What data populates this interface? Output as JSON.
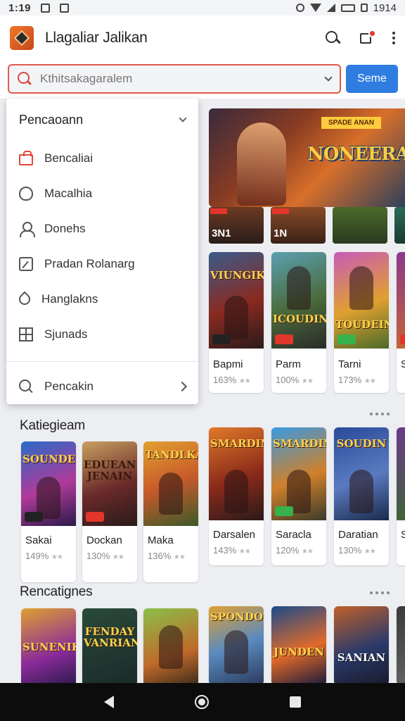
{
  "status_bar": {
    "time": "1:19",
    "right_text": "1914"
  },
  "app_bar": {
    "title": "Llagaliar Jalikan"
  },
  "search": {
    "placeholder": "Kthitsakagaralem",
    "button_label": "Seme"
  },
  "dropdown": {
    "header": "Pencaoann",
    "items": [
      {
        "label": "Bencaliai",
        "icon": "shopping-bag-icon"
      },
      {
        "label": "Macalhia",
        "icon": "shield-icon"
      },
      {
        "label": "Donehs",
        "icon": "user-icon"
      },
      {
        "label": "Pradan Rolanarg",
        "icon": "edit-icon"
      },
      {
        "label": "Hanglakns",
        "icon": "drop-icon"
      },
      {
        "label": "Sjunads",
        "icon": "grid-icon"
      }
    ],
    "footer": "Pencakin"
  },
  "hero": {
    "title": "NONEERAN",
    "tag": "SPADE ANAN"
  },
  "featured_thumbs": [
    {
      "num": "3N1"
    },
    {
      "num": "1N"
    },
    {
      "num": ""
    },
    {
      "num": ""
    }
  ],
  "row_one": [
    {
      "title_art": "VIUNGIK",
      "name": "Bapmi",
      "rating": "163%"
    },
    {
      "title_art": "ICOUDIN",
      "name": "Parm",
      "rating": "100%"
    },
    {
      "title_art": "TOUDEINE",
      "name": "Tarni",
      "rating": "173%"
    },
    {
      "title_art": "",
      "name": "S",
      "rating": ""
    }
  ],
  "sections": {
    "categories": {
      "title": "Katiegieam",
      "cards": [
        {
          "title_art": "SOUNDER",
          "name": "Sakai",
          "rating": "149%"
        },
        {
          "title_art": "EDUEAN JENAIN",
          "name": "Dockan",
          "rating": "130%"
        },
        {
          "title_art": "TANDLKAN",
          "name": "Maka",
          "rating": "136%"
        },
        {
          "title_art": "SMARDIN",
          "name": "Darsalen",
          "rating": "143%"
        },
        {
          "title_art": "SMARDIN",
          "name": "Saracla",
          "rating": "120%"
        },
        {
          "title_art": "SOUDIN",
          "name": "Daratian",
          "rating": "130%"
        },
        {
          "title_art": "",
          "name": "S",
          "rating": ""
        }
      ]
    },
    "recommendations": {
      "title": "Rencatignes",
      "cards": [
        {
          "title_art": "SUNENIK"
        },
        {
          "title_art": "FENDAY VANRIAN"
        },
        {
          "title_art": ""
        },
        {
          "title_art": "SPONDON"
        },
        {
          "title_art": "JUNDEN"
        },
        {
          "title_art": "SANIAN"
        },
        {
          "title_art": ""
        }
      ]
    }
  },
  "colors": {
    "accent": "#2f7de1",
    "search_border": "#e05a4e",
    "badge_red": "#e2362b",
    "badge_green": "#37b24d",
    "logo": "#f3772a"
  }
}
